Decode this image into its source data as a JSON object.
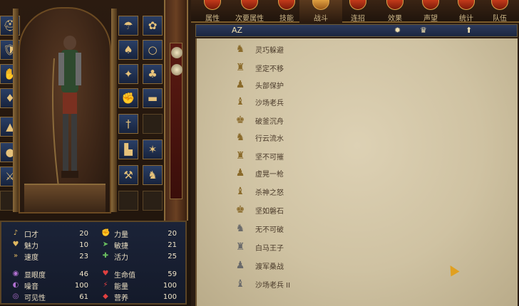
{
  "tabs": [
    {
      "label": "属性",
      "active": false
    },
    {
      "label": "次要属性",
      "active": false
    },
    {
      "label": "技能",
      "active": false
    },
    {
      "label": "战斗",
      "active": true
    },
    {
      "label": "连招",
      "active": false
    },
    {
      "label": "效果",
      "active": false
    },
    {
      "label": "声望",
      "active": false
    },
    {
      "label": "统计",
      "active": false
    },
    {
      "label": "队伍",
      "active": false
    }
  ],
  "sortbar": {
    "az": "AZ",
    "sort_icons": [
      "sun-icon",
      "crown-icon",
      "arrow-up-icon"
    ]
  },
  "perks": [
    {
      "name": "灵巧躲避",
      "icon": "perk-icon",
      "grey": false
    },
    {
      "name": "坚定不移",
      "icon": "perk-icon",
      "grey": false
    },
    {
      "name": "头部保护",
      "icon": "perk-icon",
      "grey": false
    },
    {
      "name": "沙场老兵",
      "icon": "perk-icon",
      "grey": false
    },
    {
      "name": "破釜沉舟",
      "icon": "perk-icon",
      "grey": false
    },
    {
      "name": "行云流水",
      "icon": "perk-icon",
      "grey": false
    },
    {
      "name": "坚不可摧",
      "icon": "perk-icon",
      "grey": false
    },
    {
      "name": "虚晃一枪",
      "icon": "perk-icon",
      "grey": false
    },
    {
      "name": "杀神之怒",
      "icon": "perk-icon",
      "grey": false
    },
    {
      "name": "坚如磐石",
      "icon": "perk-icon",
      "grey": false
    },
    {
      "name": "无不可破",
      "icon": "perk-icon",
      "grey": true
    },
    {
      "name": "白马王子",
      "icon": "perk-icon",
      "grey": true
    },
    {
      "name": "渡军桑战",
      "icon": "perk-icon",
      "grey": true
    },
    {
      "name": "沙场老兵 II",
      "icon": "perk-icon",
      "grey": true
    }
  ],
  "stats_left": [
    {
      "label": "口才",
      "value": "20",
      "color": "#e0b860"
    },
    {
      "label": "魅力",
      "value": "10",
      "color": "#e0b860"
    },
    {
      "label": "速度",
      "value": "23",
      "color": "#e0b860"
    },
    {
      "label": "显眼度",
      "value": "46",
      "color": "#b070d0"
    },
    {
      "label": "噪音",
      "value": "100",
      "color": "#b070d0"
    },
    {
      "label": "可见性",
      "value": "61",
      "color": "#b070d0"
    }
  ],
  "stats_right": [
    {
      "label": "力量",
      "value": "20",
      "color": "#6ac060"
    },
    {
      "label": "敏捷",
      "value": "21",
      "color": "#6ac060"
    },
    {
      "label": "活力",
      "value": "25",
      "color": "#6ac060"
    },
    {
      "label": "生命值",
      "value": "59",
      "color": "#e04040"
    },
    {
      "label": "能量",
      "value": "100",
      "color": "#e04040"
    },
    {
      "label": "营养",
      "value": "100",
      "color": "#e04040"
    }
  ],
  "equipment_icons": {
    "left_column": [
      "helmet-icon",
      "armor-icon",
      "gloves-icon",
      "shield-icon",
      "hat-icon",
      "coin-icon",
      "sword-icon",
      "empty-slot"
    ],
    "grid": [
      "hood-icon",
      "scarf-icon",
      "cloak-icon",
      "ring-icon",
      "gambeson-icon",
      "jerkin-icon",
      "gauntlet-icon",
      "belt-icon",
      "dagger-icon",
      "mace-icon",
      "boots-icon",
      "spur-icon",
      "axe-icon",
      "horse-icon",
      "bomb-icon",
      "tool-icon"
    ]
  }
}
